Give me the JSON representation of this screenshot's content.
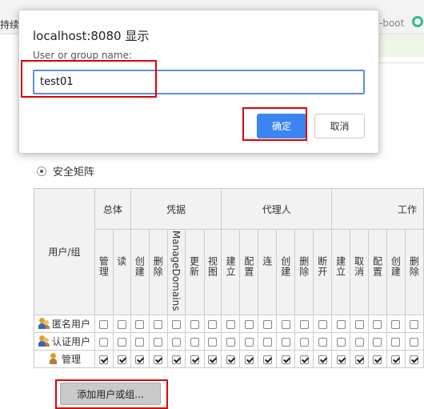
{
  "background": {
    "top_left_text": "持续",
    "top_right_text": "-boot"
  },
  "dialog": {
    "title": "localhost:8080 显示",
    "prompt": "User or group name:",
    "input_value": "test01",
    "ok_label": "确定",
    "cancel_label": "取消"
  },
  "matrix": {
    "radio_label": "安全矩阵",
    "user_header": "用户/组",
    "groups": [
      "总体",
      "凭据",
      "代理人",
      "工作"
    ],
    "permissions": [
      "管理",
      "读",
      "创建",
      "删除",
      "ManageDomains",
      "更新",
      "视图",
      "建立",
      "配置",
      "连",
      "创建",
      "删除",
      "断开",
      "建立",
      "取消",
      "配置",
      "创建",
      "删除"
    ],
    "rows": [
      {
        "name": "匿名用户",
        "checked": [
          false,
          false,
          false,
          false,
          false,
          false,
          false,
          false,
          false,
          false,
          false,
          false,
          false,
          false,
          false,
          false,
          false,
          false
        ]
      },
      {
        "name": "认证用户",
        "checked": [
          false,
          false,
          false,
          false,
          false,
          false,
          false,
          false,
          false,
          false,
          false,
          false,
          false,
          false,
          false,
          false,
          false,
          false
        ]
      },
      {
        "name": "管理",
        "checked": [
          true,
          true,
          true,
          true,
          true,
          true,
          true,
          true,
          true,
          true,
          true,
          true,
          true,
          true,
          true,
          true,
          true,
          true
        ]
      }
    ]
  },
  "add_button_label": "添加用户或组...",
  "colors": {
    "accent": "#3a86f0",
    "highlight": "#e00000"
  }
}
